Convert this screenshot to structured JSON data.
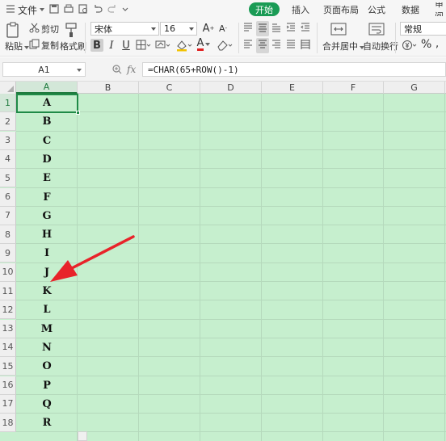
{
  "menubar": {
    "file_menu": "文件",
    "tabs": [
      "开始",
      "插入",
      "页面布局",
      "公式",
      "数据",
      "审阅"
    ],
    "active_tab": "开始"
  },
  "ribbon": {
    "paste_label": "粘贴",
    "cut_label": "剪切",
    "copy_label": "复制",
    "format_painter_label": "格式刷",
    "font_name": "宋体",
    "font_size": "16",
    "merge_center_label": "合并居中",
    "wrap_text_label": "自动换行",
    "number_format": "常规",
    "bold": "B",
    "italic": "I",
    "underline": "U",
    "font_color_letter": "A",
    "grow_font": "A",
    "shrink_font": "A"
  },
  "formula_bar": {
    "name_box": "A1",
    "fx_label": "fx",
    "formula": "=CHAR(65+ROW()-1)"
  },
  "sheet": {
    "columns": [
      "A",
      "B",
      "C",
      "D",
      "E",
      "F",
      "G"
    ],
    "row_numbers": [
      "1",
      "2",
      "3",
      "4",
      "5",
      "6",
      "7",
      "8",
      "9",
      "10",
      "11",
      "12",
      "13",
      "14",
      "15",
      "16",
      "17",
      "18"
    ],
    "column_a_values": [
      "A",
      "B",
      "C",
      "D",
      "E",
      "F",
      "G",
      "H",
      "I",
      "J",
      "K",
      "L",
      "M",
      "N",
      "O",
      "P",
      "Q",
      "R"
    ],
    "selected_cell": "A1"
  },
  "colors": {
    "accent": "#1a9b55",
    "sheet_fill": "#c6efce",
    "annotation_arrow": "#e8232a"
  }
}
